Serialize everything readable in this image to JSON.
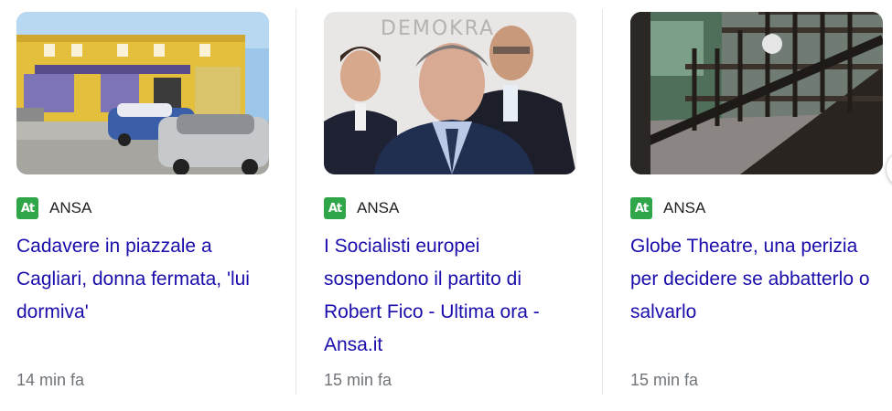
{
  "cards": [
    {
      "source": "ANSA",
      "logo_text": "At",
      "image_icon": "news-photo-parking-lot",
      "title": "Cadavere in piazzale a Cagliari, donna fermata, 'lui dormiva'",
      "time": "14 min fa"
    },
    {
      "source": "ANSA",
      "logo_text": "At",
      "image_icon": "news-photo-politicians",
      "image_overlay_text": "DEMOKRA",
      "title": "I Socialisti europei sospendono il partito di Robert Fico - Ultima ora - Ansa.it",
      "time": "15 min fa"
    },
    {
      "source": "ANSA",
      "logo_text": "At",
      "image_icon": "news-photo-wooden-stairs",
      "title": "Globe Theatre, una perizia per decidere se abbatterlo o salvarlo",
      "time": "15 min fa"
    }
  ],
  "colors": {
    "link": "#1a0dab",
    "meta": "#70757a",
    "logo_bg": "#2fa64a"
  }
}
